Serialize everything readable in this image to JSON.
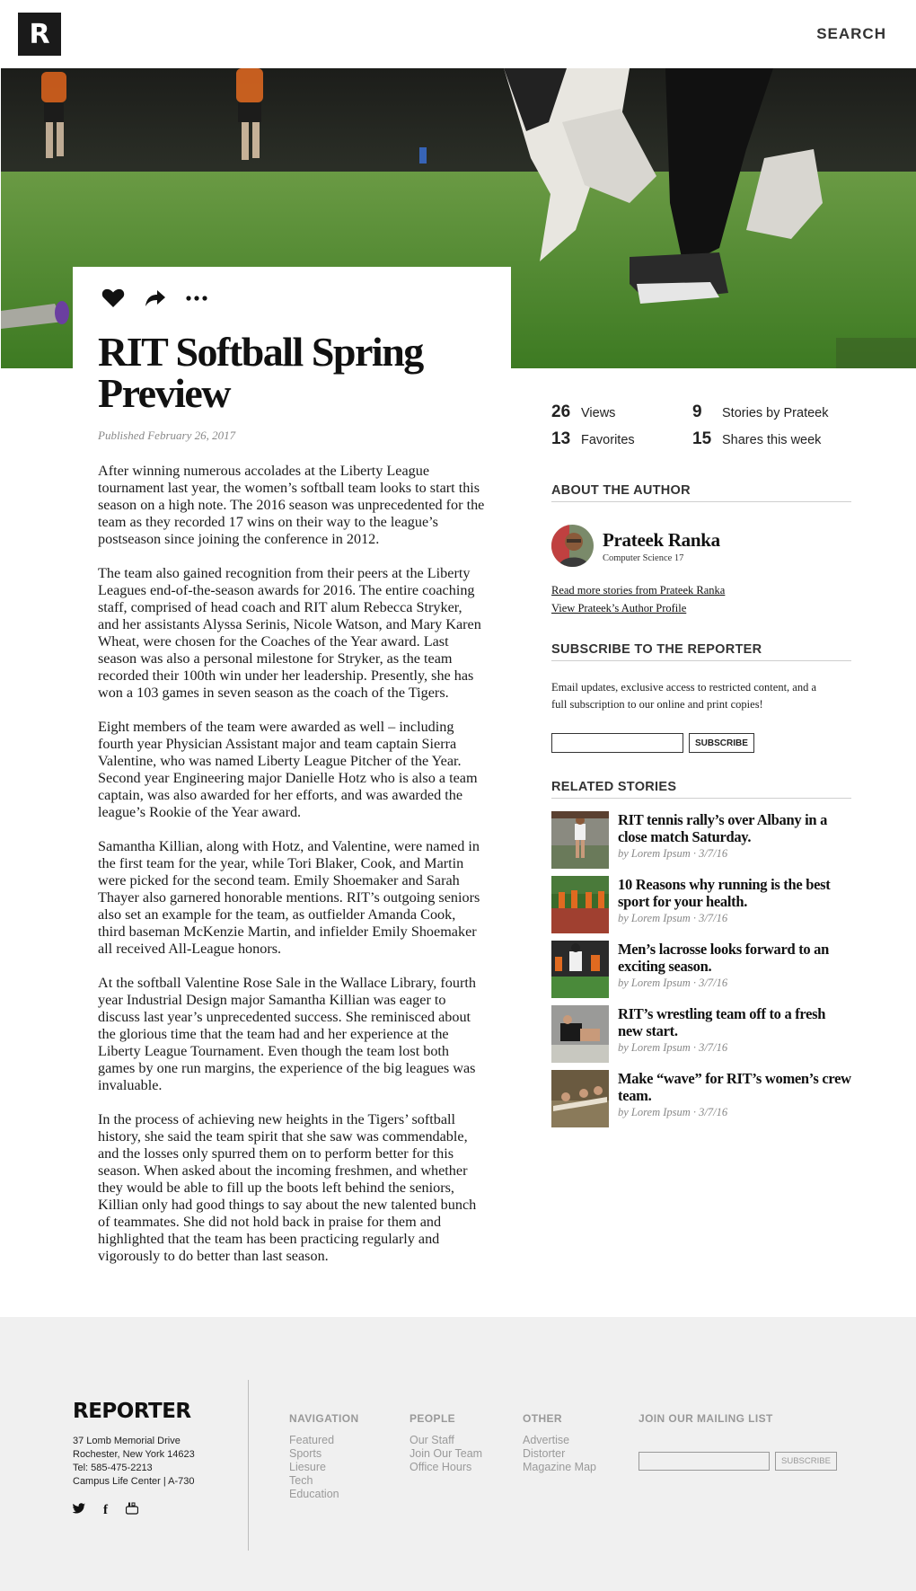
{
  "header": {
    "logo": "R",
    "search_label": "SEARCH"
  },
  "article": {
    "title": "RIT Softball Spring Preview",
    "published": "Published February 26, 2017",
    "paragraphs": [
      "After winning numerous accolades at the Liberty League tournament last year, the women’s softball team looks to start this season on a high note. The 2016 season was unprecedented for the team as they recorded 17 wins on their way to the league’s postseason since joining the conference in 2012.",
      "The team also gained recognition from their peers at the Liberty Leagues end-of-the-season awards for 2016. The entire coaching staff, comprised of head coach and RIT alum Rebecca Stryker, and her assistants Alyssa Serinis, Nicole Watson, and Mary Karen Wheat, were chosen for the Coaches of the Year award. Last season was also a personal milestone for Stryker, as the team recorded their 100th win under her leadership. Presently, she has won a 103 games in seven season as the coach of the Tigers.",
      "Eight members of the team were awarded as well – including fourth year Physician Assistant major and team captain Sierra Valentine, who was named Liberty League Pitcher of the Year. Second year Engineering major Danielle Hotz who is also a team captain, was also awarded for her efforts, and was awarded the league’s Rookie of the Year award.",
      "Samantha Killian, along with Hotz, and Valentine, were named in the first team for the year, while Tori Blaker, Cook, and Martin were picked for the second team. Emily Shoemaker and Sarah Thayer also garnered honorable mentions. RIT’s outgoing seniors also set an example for the team, as outfielder Amanda Cook, third baseman McKenzie Martin, and infielder Emily Shoemaker all received All-League honors.",
      "At the softball Valentine Rose Sale in the Wallace Library, fourth year Industrial Design major Samantha Killian was eager to discuss last year’s unprecedented success. She reminisced about the glorious time that the team had and her experience at the Liberty League Tournament. Even though the team lost both games by one run margins, the experience of the big leagues was invaluable.",
      "In the process of achieving new heights in the Tigers’ softball history, she said the team spirit that she saw was commendable, and the losses only spurred them on to perform better for this season. When asked about the incoming freshmen, and whether they would be able to fill up the boots left behind the seniors, Killian only had good things to say about the new talented bunch of teammates. She did not hold back in praise for them and highlighted that the team has been practicing regularly and vigorously to do better than last season."
    ]
  },
  "stats": [
    {
      "num": "26",
      "label": "Views"
    },
    {
      "num": "9",
      "label": "Stories by Prateek"
    },
    {
      "num": "13",
      "label": "Favorites"
    },
    {
      "num": "15",
      "label": "Shares this week"
    }
  ],
  "author": {
    "heading": "ABOUT THE AUTHOR",
    "name": "Prateek Ranka",
    "major": "Computer Science 17",
    "link_more": "Read more stories from Prateek Ranka",
    "link_profile": "View Prateek’s Author Profile"
  },
  "subscribe": {
    "heading": "SUBSCRIBE TO THE REPORTER",
    "description": "Email updates, exclusive access to restricted content, and a full subscription to our online and print copies!",
    "input_placeholder": "",
    "button": "SUBSCRIBE"
  },
  "related": {
    "heading": "RELATED STORIES",
    "items": [
      {
        "title": "RIT tennis rally’s over Albany in a close match Saturday.",
        "author": "by Lorem Ipsum",
        "date": "3/7/16"
      },
      {
        "title": "10 Reasons why running is the best sport for your health.",
        "author": "by Lorem Ipsum",
        "date": "3/7/16"
      },
      {
        "title": "Men’s lacrosse looks forward to an exciting season.",
        "author": "by Lorem Ipsum",
        "date": "3/7/16"
      },
      {
        "title": "RIT’s wrestling team off to a fresh new start.",
        "author": "by Lorem Ipsum",
        "date": "3/7/16"
      },
      {
        "title": "Make “wave” for RIT’s women’s crew team.",
        "author": "by Lorem Ipsum",
        "date": "3/7/16"
      }
    ],
    "separator": "·"
  },
  "footer": {
    "brand": "REPORTER",
    "address": [
      "37 Lomb Memorial Drive",
      "Rochester, New York 14623",
      "Tel: 585-475-2213",
      "Campus Life Center | A-730"
    ],
    "social_icons": [
      "twitter-icon",
      "facebook-icon",
      "youtube-icon"
    ],
    "social_glyphs": [
      "🐦",
      "f",
      "▶"
    ],
    "navigation": {
      "heading": "NAVIGATION",
      "links": [
        "Featured",
        "Sports",
        "Liesure",
        "Tech",
        "Education"
      ]
    },
    "people": {
      "heading": "PEOPLE",
      "links": [
        "Our Staff",
        "Join Our Team",
        "Office Hours"
      ]
    },
    "other": {
      "heading": "OTHER",
      "links": [
        "Advertise",
        "Distorter",
        "Magazine Map"
      ]
    },
    "mailing": {
      "heading": "JOIN OUR MAILING LIST",
      "button": "SUBSCRIBE"
    }
  },
  "colors": {
    "footer_bg": "#f0f0f0",
    "text": "#111111",
    "muted": "#999999",
    "grass": "#4f8a2c"
  }
}
